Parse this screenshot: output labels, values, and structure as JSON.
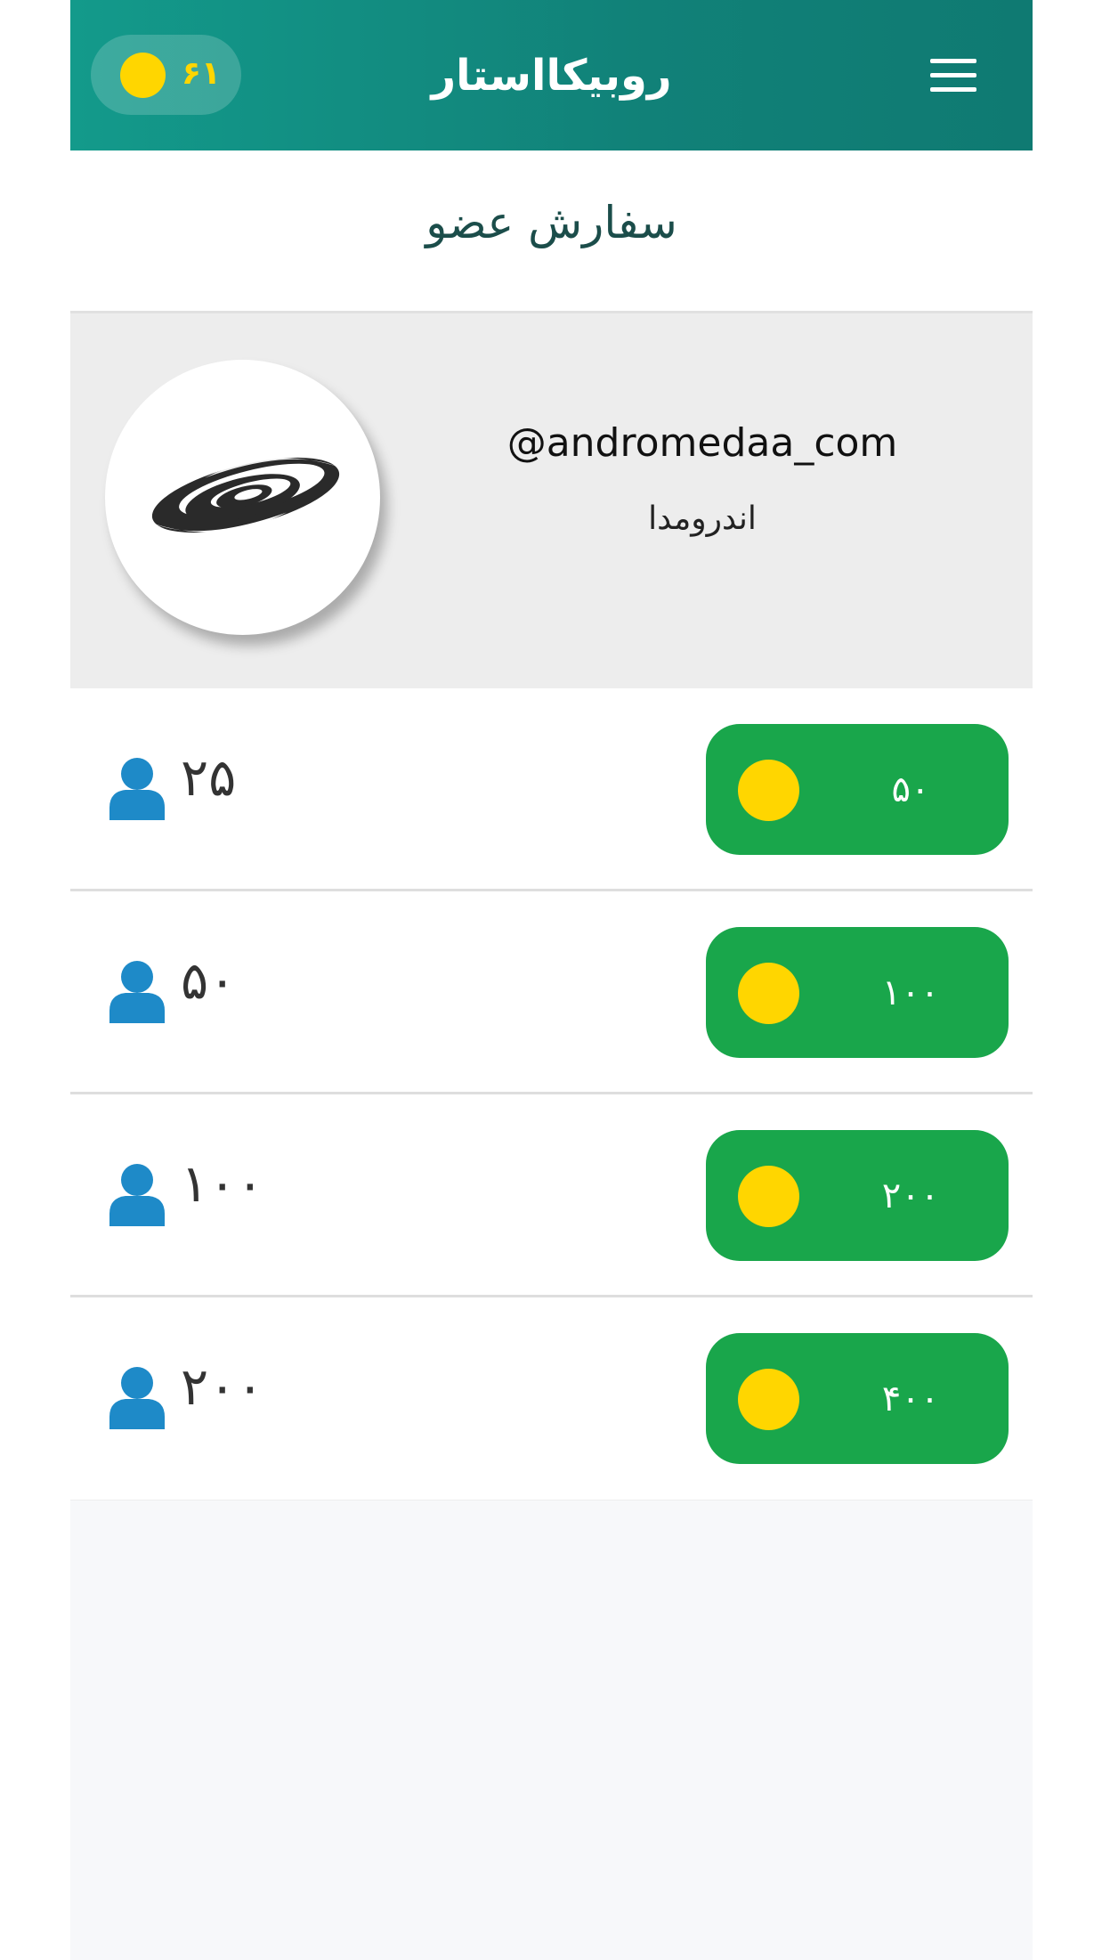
{
  "header": {
    "app_title": "روبیکااستار",
    "coin_balance": "۶۱",
    "menu_icon": "hamburger-menu-icon",
    "coin_icon": "coin-icon"
  },
  "page": {
    "title": "سفارش عضو"
  },
  "profile": {
    "username": "@andromedaa_com",
    "display_name": "اندرومدا",
    "avatar_icon": "galaxy-logo"
  },
  "packages": [
    {
      "members": "۲۵",
      "price": "۵۰"
    },
    {
      "members": "۵۰",
      "price": "۱۰۰"
    },
    {
      "members": "۱۰۰",
      "price": "۲۰۰"
    },
    {
      "members": "۲۰۰",
      "price": "۴۰۰"
    }
  ],
  "colors": {
    "header_start": "#139a8b",
    "header_end": "#0f7a72",
    "coin": "#ffd600",
    "buy_button": "#19a64b",
    "user_icon": "#1e8ac8"
  }
}
